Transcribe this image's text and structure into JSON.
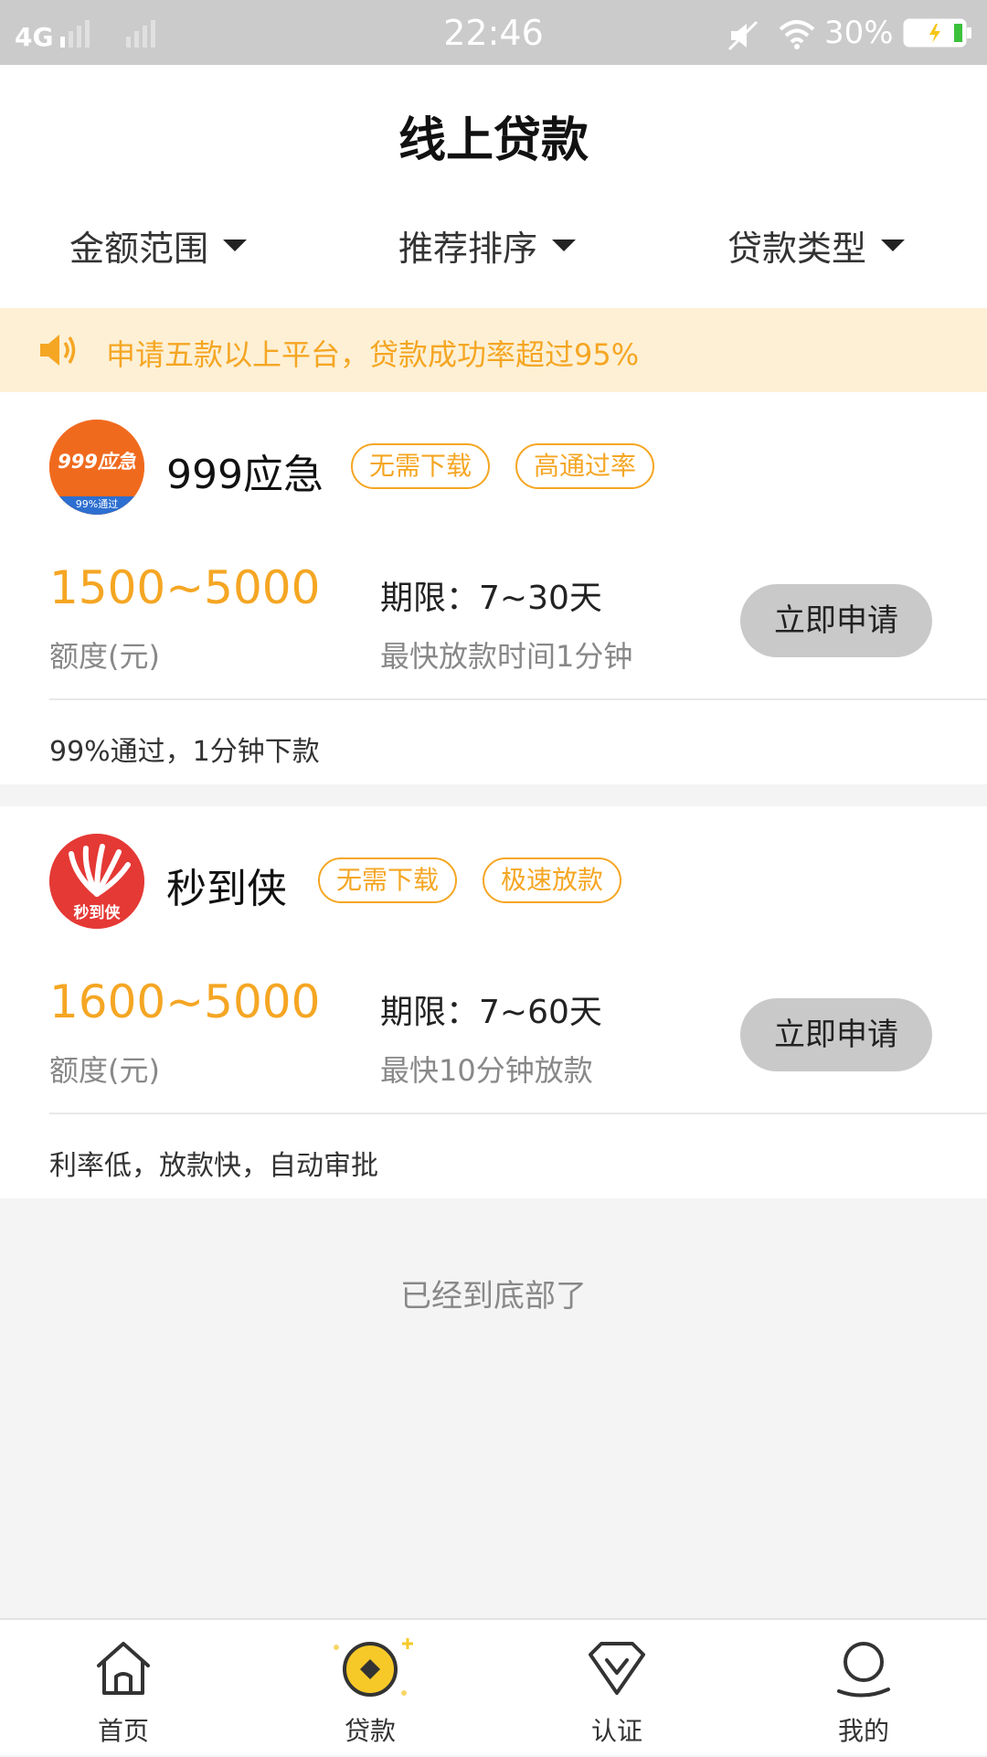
{
  "status_bar": {
    "network": "4G",
    "time": "22:46",
    "battery": "30%"
  },
  "header": {
    "title": "线上贷款",
    "filters": [
      "金额范围",
      "推荐排序",
      "贷款类型"
    ]
  },
  "notice": {
    "text": "申请五款以上平台，贷款成功率超过95%"
  },
  "products": [
    {
      "name": "999应急",
      "logo_text": "999应急",
      "logo_subtext": "99%通过",
      "tags": [
        "无需下载",
        "高通过率"
      ],
      "amount": "1500~5000",
      "amount_label": "额度(元)",
      "term": "期限：7~30天",
      "term_desc": "最快放款时间1分钟",
      "apply_label": "立即申请",
      "desc": "99%通过，1分钟下款"
    },
    {
      "name": "秒到侠",
      "logo_text": "秒到侠",
      "tags": [
        "无需下载",
        "极速放款"
      ],
      "amount": "1600~5000",
      "amount_label": "额度(元)",
      "term": "期限：7~60天",
      "term_desc": "最快10分钟放款",
      "apply_label": "立即申请",
      "desc": "利率低，放款快，自动审批"
    }
  ],
  "end_text": "已经到底部了",
  "bottom_nav": [
    {
      "label": "首页",
      "icon": "home-icon"
    },
    {
      "label": "贷款",
      "icon": "loan-icon",
      "active": true
    },
    {
      "label": "认证",
      "icon": "verify-icon"
    },
    {
      "label": "我的",
      "icon": "profile-icon"
    }
  ],
  "colors": {
    "accent": "#f5a623",
    "notice_bg": "#fdf0d5",
    "status_bar_bg": "#cbcbcb",
    "button_bg": "#c9c9c9",
    "loan_icon_yellow": "#f7c928"
  }
}
